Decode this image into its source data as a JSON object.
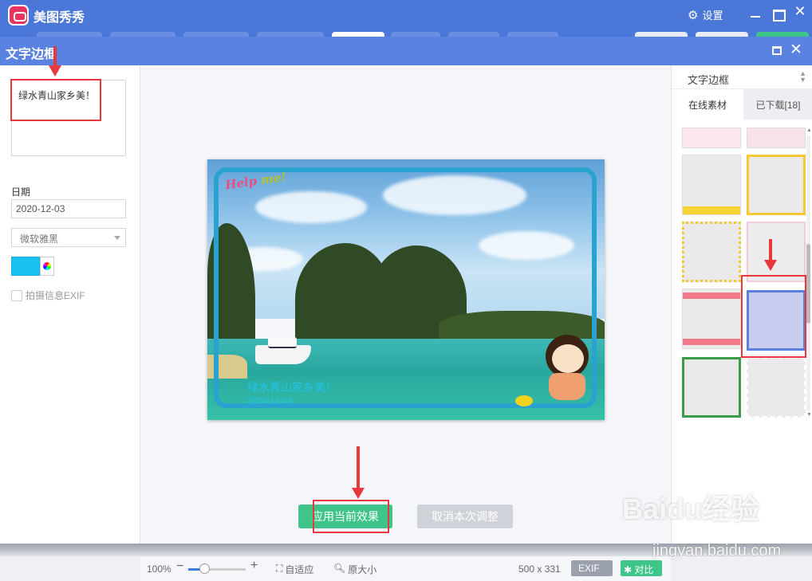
{
  "app": {
    "title": "美图秀秀",
    "settings_label": "设置"
  },
  "dialog": {
    "title": "文字边框"
  },
  "left_panel": {
    "text_value": "绿水青山家乡美！",
    "date_label": "日期",
    "date_value": "2020-12-03",
    "font_value": "微软雅黑",
    "text_color": "#19c2f0",
    "exif_label": "拍摄信息EXIF"
  },
  "canvas": {
    "photo_text": "绿水青山家乡美！",
    "photo_date": "2020-12-03",
    "frame_color": "#2aa2d0",
    "apply_label": "应用当前效果",
    "cancel_label": "取消本次调整"
  },
  "right_panel": {
    "category_value": "文字边框",
    "tabs": [
      {
        "label": "在线素材",
        "active": true
      },
      {
        "label": "已下载[18]",
        "active": false
      }
    ]
  },
  "bottombar": {
    "zoom": "100%",
    "fit_label": "自适应",
    "original_label": "原大小",
    "dimensions": "500 x 331",
    "exif_label": "EXIF",
    "compare_label": "对比"
  },
  "watermark": {
    "logo": "Baidu经验",
    "url": "jingyan.baidu.com"
  },
  "icons": {
    "settings": "gear-icon",
    "minimize": "minimize-icon",
    "maximize": "maximize-icon",
    "close": "close-icon",
    "fit": "fit-screen-icon",
    "original": "magnifier-icon",
    "compare": "star-compare-icon"
  }
}
